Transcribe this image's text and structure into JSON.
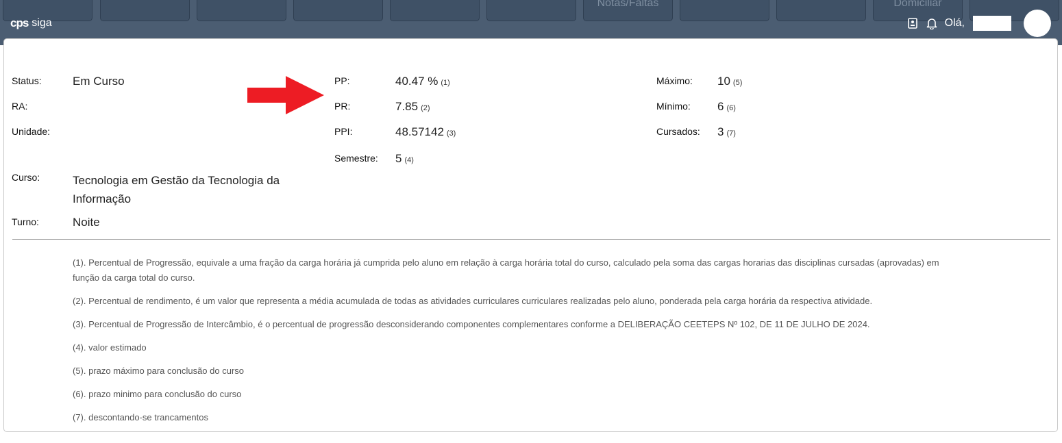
{
  "header": {
    "brand_logo": "cps",
    "brand_name": "siga",
    "tabs": [
      "",
      "",
      "",
      "",
      "",
      "",
      "Notas/Faltas",
      "",
      "",
      "Domiciliar",
      ""
    ],
    "greeting": "Olá,"
  },
  "summary": {
    "status_label": "Status:",
    "status_value": "Em Curso",
    "ra_label": "RA:",
    "unidade_label": "Unidade:",
    "curso_label": "Curso:",
    "curso_line1": "Tecnologia em Gestão da Tecnologia da",
    "curso_line2": "Informação",
    "turno_label": "Turno:",
    "turno_value": "Noite",
    "pp_label": "PP:",
    "pp_value": "40.47 %",
    "pp_ref": "(1)",
    "pr_label": "PR:",
    "pr_value": "7.85",
    "pr_ref": "(2)",
    "ppi_label": "PPI:",
    "ppi_value": "48.57142",
    "ppi_ref": "(3)",
    "semestre_label": "Semestre:",
    "semestre_value": "5",
    "semestre_ref": "(4)",
    "maximo_label": "Máximo:",
    "maximo_value": "10",
    "maximo_ref": "(5)",
    "minimo_label": "Mínimo:",
    "minimo_value": "6",
    "minimo_ref": "(6)",
    "cursados_label": "Cursados:",
    "cursados_value": "3",
    "cursados_ref": "(7)"
  },
  "notes": {
    "n1_line1": "(1). Percentual de Progressão, equivale a uma fração da carga horária já cumprida pelo aluno em relação à carga horária total do curso, calculado pela soma das cargas horarias das disciplinas cursadas (aprovadas) em",
    "n1_line2": "função da carga total do curso.",
    "n2": "(2). Percentual de rendimento, é um valor que representa a média acumulada de todas as atividades curriculares curriculares realizadas pelo aluno, ponderada pela carga horária da respectiva atividade.",
    "n3": "(3). Percentual de Progressão de Intercâmbio, é o percentual de progressão desconsiderando componentes complementares conforme a DELIBERAÇÃO CEETEPS Nº 102, DE 11 DE JULHO DE 2024.",
    "n4": "(4). valor estimado",
    "n5": "(5). prazo máximo para conclusão do curso",
    "n6": "(6). prazo minimo para conclusão do curso",
    "n7": "(7). descontando-se trancamentos"
  },
  "annotation": {
    "arrow_color": "#ed1c24"
  }
}
